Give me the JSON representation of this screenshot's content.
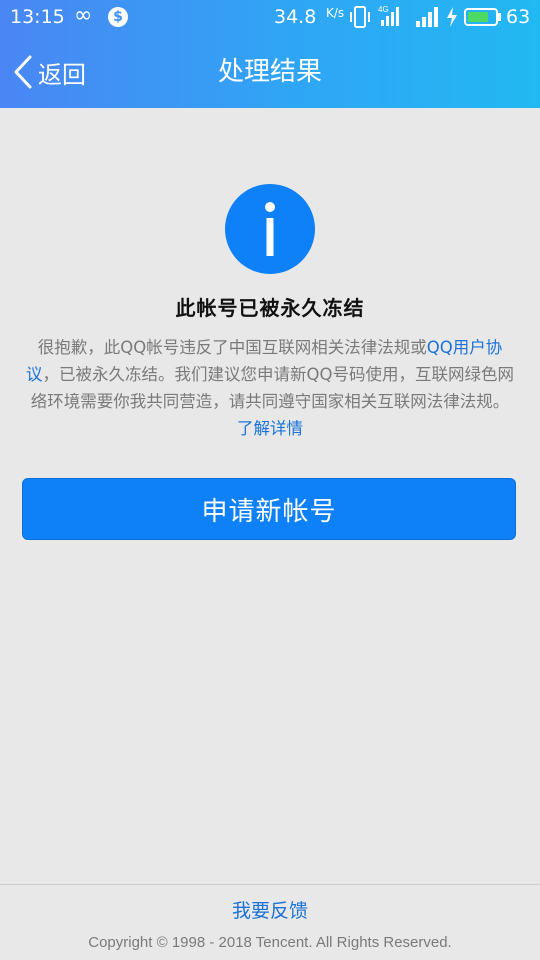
{
  "status_bar": {
    "time": "13:15",
    "speed": "34.8",
    "speed_unit": "K/s",
    "battery_level": "63",
    "icons": [
      "infinity-icon",
      "dollar-icon",
      "vibrate-icon",
      "4g-signal-icon",
      "signal-icon",
      "charging-icon",
      "battery-icon"
    ]
  },
  "nav": {
    "back_label": "返回",
    "title": "处理结果"
  },
  "content": {
    "headline": "此帐号已被永久冻结",
    "message_part1": "很抱歉，此QQ帐号违反了中国互联网相关法律法规或",
    "message_link1": "QQ用户协议",
    "message_part2": "，已被永久冻结。我们建议您申请新QQ号码使用，互联网绿色网络环境需要你我共同营造，请共同遵守国家相关互联网法律法规。",
    "message_link2": "了解详情",
    "apply_button": "申请新帐号"
  },
  "footer": {
    "feedback": "我要反馈",
    "copyright": "Copyright © 1998 - 2018 Tencent. All Rights Reserved."
  },
  "colors": {
    "header_start": "#4a86f4",
    "header_end": "#22b8f2",
    "primary_button": "#0e80f8",
    "link": "#1a73d8",
    "background": "#e8e8e8"
  }
}
